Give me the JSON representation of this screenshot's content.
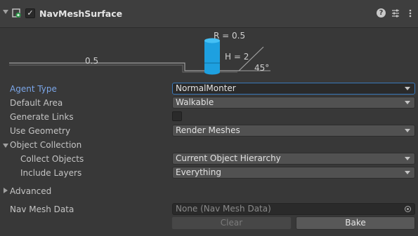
{
  "component": {
    "title": "NavMeshSurface",
    "enabled": true,
    "icons": {
      "component": "navmesh-surface-icon",
      "help": "help-icon",
      "presets": "presets-icon",
      "menu": "context-menu-icon"
    },
    "help_glyph": "?",
    "check_glyph": "✓"
  },
  "agent_diagram": {
    "radius_label": "R = 0.5",
    "height_label": "H = 2",
    "step_label": "0.5",
    "slope_label": "45°",
    "agent_color": "#1ea0e0"
  },
  "fields": {
    "agent_type": {
      "label": "Agent Type",
      "value": "NormalMonter"
    },
    "default_area": {
      "label": "Default Area",
      "value": "Walkable"
    },
    "generate_links": {
      "label": "Generate Links",
      "checked": false
    },
    "use_geometry": {
      "label": "Use Geometry",
      "value": "Render Meshes"
    },
    "object_collection": {
      "label": "Object Collection",
      "expanded": true
    },
    "collect_objects": {
      "label": "Collect Objects",
      "value": "Current Object Hierarchy"
    },
    "include_layers": {
      "label": "Include Layers",
      "value": "Everything"
    },
    "advanced": {
      "label": "Advanced",
      "expanded": false
    },
    "nav_mesh_data": {
      "label": "Nav Mesh Data",
      "value": "None (Nav Mesh Data)"
    }
  },
  "buttons": {
    "clear": "Clear",
    "bake": "Bake"
  },
  "colors": {
    "focus_label": "#7ba6e8",
    "focus_border": "#3a79bb"
  }
}
